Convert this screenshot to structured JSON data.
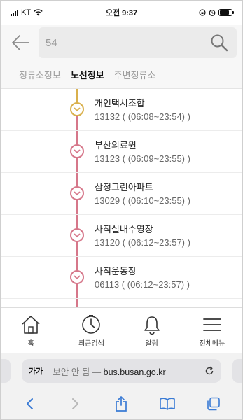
{
  "status_bar": {
    "carrier": "KT",
    "time": "오전 9:37"
  },
  "search": {
    "value": "54",
    "icon": "search-icon"
  },
  "tabs": [
    {
      "label": "정류소정보",
      "active": false
    },
    {
      "label": "노선정보",
      "active": true
    },
    {
      "label": "주변정류소",
      "active": false
    }
  ],
  "stops": [
    {
      "name": "개인택시조합",
      "info": "13132 ( (06:08~23:54) )",
      "marker_color": "#d9b04c"
    },
    {
      "name": "부산의료원",
      "info": "13123 ( (06:09~23:55) )",
      "marker_color": "#d6778a"
    },
    {
      "name": "삼정그린아파트",
      "info": "13029 ( (06:10~23:55) )",
      "marker_color": "#d6778a"
    },
    {
      "name": "사직실내수영장",
      "info": "13120 ( (06:12~23:57) )",
      "marker_color": "#d6778a"
    },
    {
      "name": "사직운동장",
      "info": "06113 ( (06:12~23:57) )",
      "marker_color": "#d6778a"
    }
  ],
  "route_colors": {
    "upper": "#d9b04c",
    "lower": "#d6778a"
  },
  "bottom_nav": [
    {
      "label": "홈",
      "icon": "home-icon"
    },
    {
      "label": "최근검색",
      "icon": "clock-icon"
    },
    {
      "label": "알림",
      "icon": "bell-icon"
    },
    {
      "label": "전체메뉴",
      "icon": "menu-icon"
    }
  ],
  "browser": {
    "text_size_label": "가가",
    "insecure_label": "보안 안 됨 — ",
    "domain": "bus.busan.go.kr"
  }
}
